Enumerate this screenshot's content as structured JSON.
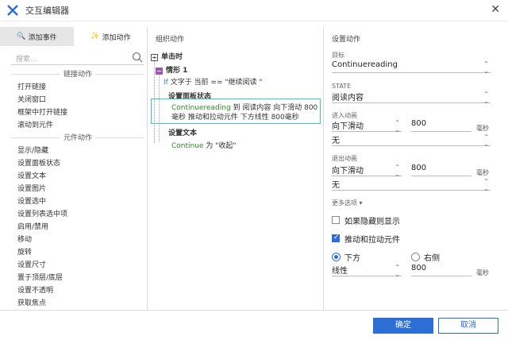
{
  "window": {
    "title": "交互编辑器"
  },
  "left": {
    "tabs": [
      {
        "label": "添加事件"
      },
      {
        "label": "添加动作"
      }
    ],
    "search_placeholder": "搜索...",
    "sections": [
      {
        "title": "链接动作",
        "items": [
          "打开链接",
          "关闭窗口",
          "框架中打开链接",
          "滚动到元件"
        ]
      },
      {
        "title": "元件动作",
        "items": [
          "显示/隐藏",
          "设置面板状态",
          "设置文本",
          "设置图片",
          "设置选中",
          "设置列表选中项",
          "启用/禁用",
          "移动",
          "旋转",
          "设置尺寸",
          "置于顶层/底层",
          "设置不透明",
          "获取焦点"
        ]
      }
    ]
  },
  "middle": {
    "header": "组织动作",
    "event": "单击时",
    "case": "情形 1",
    "condition_if": "If",
    "condition_text": " 文字于 当前 == \"继续阅读 \"",
    "action1_title": "设置面板状态",
    "action1_target": "Continuereading",
    "action1_desc_a": " 到 阅读内容 向下滑动 800",
    "action1_desc_b": "毫秒 推动和拉动元件 下方线性 800毫秒",
    "action2_title": "设置文本",
    "action2_target": "Continue",
    "action2_desc": " 为 \"收起\""
  },
  "right": {
    "header": "设置动作",
    "target_label": "目标",
    "target_value": "Continuereading",
    "state_label": "STATE",
    "state_value": "阅读内容",
    "enter_label": "进入动画",
    "enter_anim": "向下滑动",
    "enter_ms": "800",
    "enter_unit": "毫秒",
    "enter_easing": "无",
    "exit_label": "退出动画",
    "exit_anim": "向下滑动",
    "exit_ms": "800",
    "exit_unit": "毫秒",
    "exit_easing": "无",
    "more_options": "更多选项 ▾",
    "show_if_hidden": "如果隐藏则显示",
    "push_pull": "推动和拉动元件",
    "radio_below": "下方",
    "radio_right": "右侧",
    "push_easing": "线性",
    "push_ms": "800",
    "push_unit": "毫秒"
  },
  "buttons": {
    "ok": "确定",
    "cancel": "取消"
  },
  "colors": {
    "accent": "#2c6ed6",
    "selection": "#3cc6c6",
    "case_toggle": "#9b59b6"
  }
}
